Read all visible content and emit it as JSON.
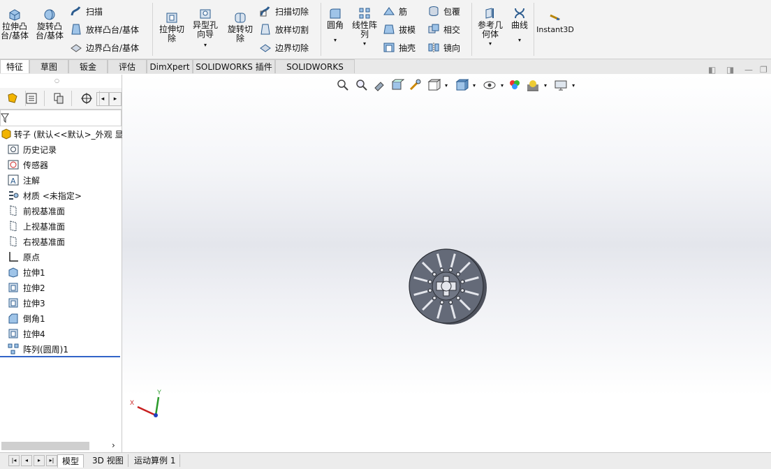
{
  "ribbon": {
    "extrude_boss": "拉伸凸\n台/基体",
    "revolve_boss": "旋转凸\n台/基体",
    "sweep": "扫描",
    "loft_boss": "放样凸台/基体",
    "boundary_boss": "边界凸台/基体",
    "extrude_cut": "拉伸切\n除",
    "hole_wizard": "异型孔\n向导",
    "revolve_cut": "旋转切\n除",
    "swept_cut": "扫描切除",
    "lofted_cut": "放样切割",
    "boundary_cut": "边界切除",
    "fillet": "圆角",
    "linear_pattern": "线性阵\n列",
    "rib": "筋",
    "draft": "拔模",
    "shell": "抽壳",
    "wrap": "包覆",
    "intersect": "相交",
    "mirror": "镜向",
    "ref_geometry": "参考几\n何体",
    "curves": "曲线",
    "instant3d": "Instant3D"
  },
  "tabs": [
    "特征",
    "草图",
    "钣金",
    "评估",
    "DimXpert",
    "SOLIDWORKS 插件",
    "SOLIDWORKS MBD"
  ],
  "tree": {
    "root": "转子 (默认<<默认>_外观 显示",
    "items": [
      {
        "label": "历史记录",
        "icon": "history-icon"
      },
      {
        "label": "传感器",
        "icon": "sensor-icon"
      },
      {
        "label": "注解",
        "icon": "annotation-icon"
      },
      {
        "label": "材质 <未指定>",
        "icon": "material-icon"
      },
      {
        "label": "前视基准面",
        "icon": "plane-icon"
      },
      {
        "label": "上视基准面",
        "icon": "plane-icon"
      },
      {
        "label": "右视基准面",
        "icon": "plane-icon"
      },
      {
        "label": "原点",
        "icon": "origin-icon"
      },
      {
        "label": "拉伸1",
        "icon": "extrude-feature-icon"
      },
      {
        "label": "拉伸2",
        "icon": "extrude-cut-feature-icon"
      },
      {
        "label": "拉伸3",
        "icon": "extrude-cut-feature-icon"
      },
      {
        "label": "倒角1",
        "icon": "chamfer-feature-icon"
      },
      {
        "label": "拉伸4",
        "icon": "extrude-cut-feature-icon"
      },
      {
        "label": "阵列(圆周)1",
        "icon": "circular-pattern-icon"
      }
    ]
  },
  "triad": {
    "x": "X",
    "y": "Y"
  },
  "bottom_tabs": [
    "模型",
    "3D 视图",
    "运动算例 1"
  ],
  "colors": {
    "part": "#5f6472",
    "accent": "#1f5fbf",
    "selection": "#3264c8"
  }
}
